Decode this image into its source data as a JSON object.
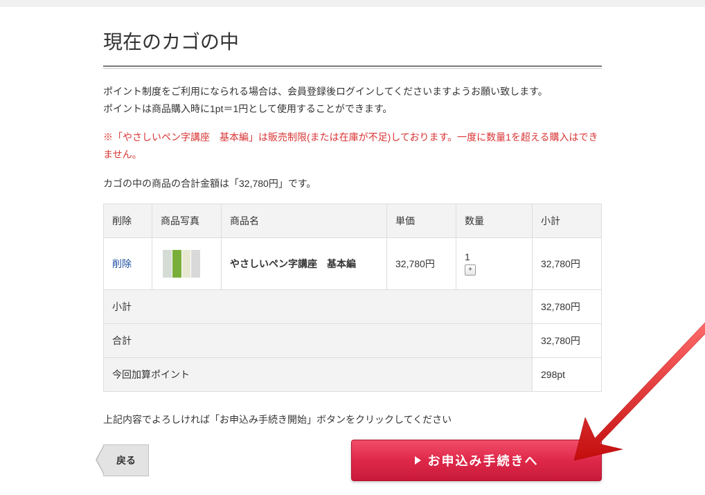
{
  "page": {
    "heading": "現在のカゴの中"
  },
  "notices": {
    "point_info_1": "ポイント制度をご利用になられる場合は、会員登録後ログインしてくださいますようお願い致します。",
    "point_info_2": "ポイントは商品購入時に1pt＝1円として使用することができます。",
    "stock_warning": "※「やさしいペン字講座　基本編」は販売制限(または在庫が不足)しております。一度に数量1を超える購入はできません。",
    "total_summary": "カゴの中の商品の合計金額は「32,780円」です。",
    "confirm_prompt": "上記内容でよろしければ「お申込み手続き開始」ボタンをクリックしてください"
  },
  "table": {
    "headers": {
      "delete": "削除",
      "photo": "商品写真",
      "name": "商品名",
      "unit_price": "単価",
      "quantity": "数量",
      "subtotal": "小計"
    },
    "items": [
      {
        "delete_label": "削除",
        "name": "やさしいペン字講座　基本編",
        "unit_price": "32,780円",
        "quantity": "1",
        "subtotal": "32,780円"
      }
    ],
    "totals": {
      "subtotal_label": "小計",
      "subtotal_value": "32,780円",
      "total_label": "合計",
      "total_value": "32,780円",
      "points_label": "今回加算ポイント",
      "points_value": "298pt"
    }
  },
  "buttons": {
    "back": "戻る",
    "proceed": "お申込み手続きへ"
  },
  "colors": {
    "warning": "#d93434",
    "primary": "#df2849"
  }
}
